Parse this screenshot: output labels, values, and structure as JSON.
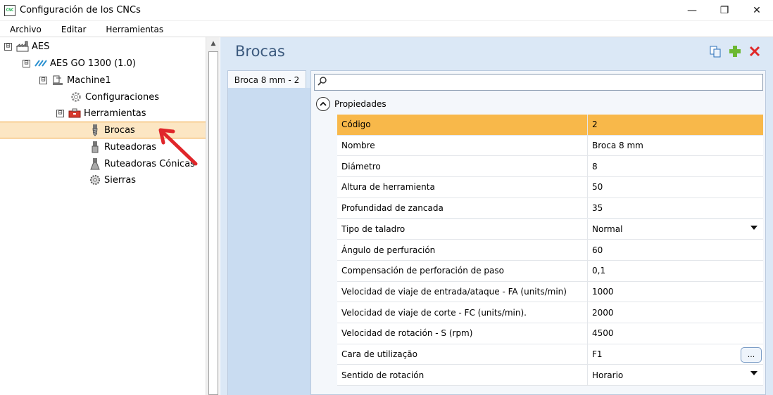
{
  "window": {
    "title": "Configuración de los CNCs",
    "app_icon": "cnc-icon",
    "app_icon_text": "CNC",
    "controls": {
      "minimize": "—",
      "restore": "❐",
      "close": "✕"
    }
  },
  "menu": [
    "Archivo",
    "Editar",
    "Herramientas"
  ],
  "tree": {
    "root": {
      "label": "AES",
      "icon": "factory-icon",
      "expander": "⊟"
    },
    "machine_group": {
      "label": "AES GO 1300 (1.0)",
      "icon": "aes-logo-icon",
      "expander": "⊟"
    },
    "machine": {
      "label": "Machine1",
      "icon": "machine-icon",
      "expander": "⊟"
    },
    "configuraciones": {
      "label": "Configuraciones",
      "icon": "gear-icon"
    },
    "herramientas": {
      "label": "Herramientas",
      "icon": "toolbox-icon",
      "expander": "⊟"
    },
    "brocas": {
      "label": "Brocas",
      "icon": "drill-bit-icon"
    },
    "ruteadoras": {
      "label": "Ruteadoras",
      "icon": "router-bit-icon"
    },
    "ruteadoras_conicas": {
      "label": "Ruteadoras Cónicas",
      "icon": "conical-router-icon"
    },
    "sierras": {
      "label": "Sierras",
      "icon": "saw-blade-icon"
    }
  },
  "panel": {
    "title": "Brocas",
    "tab_label": "Broca 8 mm - 2",
    "search_placeholder": "",
    "group_label": "Propiedades",
    "rows": [
      {
        "name": "Código",
        "value": "2"
      },
      {
        "name": "Nombre",
        "value": "Broca 8 mm"
      },
      {
        "name": "Diámetro",
        "value": "8"
      },
      {
        "name": "Altura de herramienta",
        "value": "50"
      },
      {
        "name": "Profundidad de zancada",
        "value": "35"
      },
      {
        "name": "Tipo de taladro",
        "value": "Normal"
      },
      {
        "name": "Ángulo de perfuración",
        "value": "60"
      },
      {
        "name": "Compensación de perforación de paso",
        "value": "0,1"
      },
      {
        "name": "Velocidad de viaje de entrada/ataque - FA (units/min)",
        "value": "1000"
      },
      {
        "name": "Velocidad de viaje de corte - FC (units/min).",
        "value": "2000"
      },
      {
        "name": "Velocidad de rotación - S (rpm)",
        "value": "4500"
      },
      {
        "name": "Cara de utilização",
        "value": "F1"
      },
      {
        "name": "Sentido de rotación",
        "value": "Horario"
      }
    ],
    "ellipsis_label": "...",
    "colors": {
      "selected_row": "#f8b84a",
      "panel_bg": "#dbe8f6",
      "title": "#3c5a7e",
      "tree_selected": "#fce6c3"
    }
  }
}
